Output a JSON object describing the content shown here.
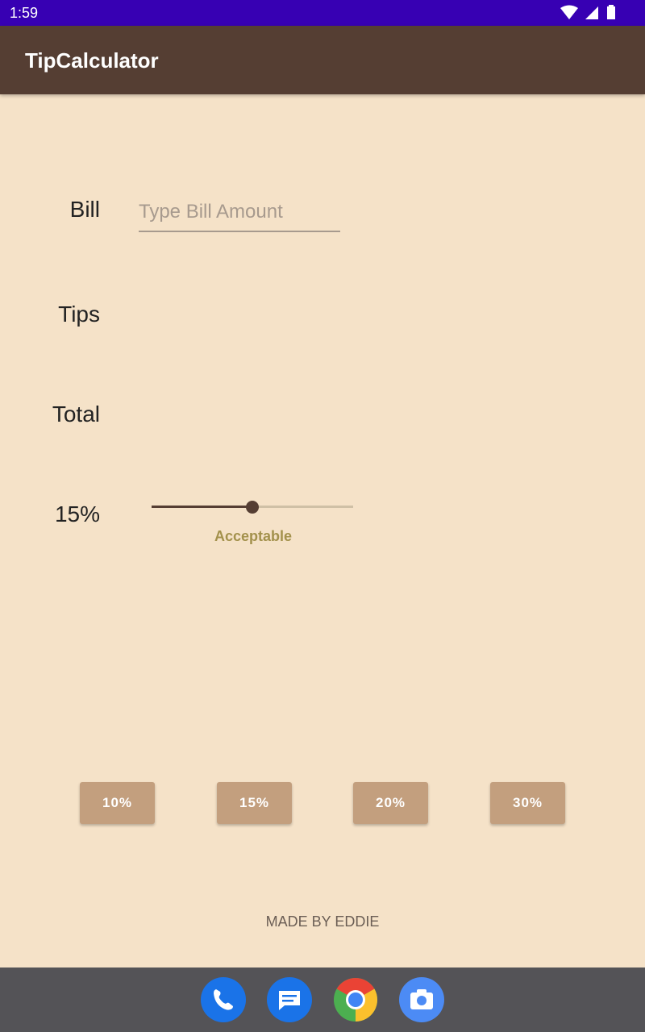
{
  "status_bar": {
    "time": "1:59"
  },
  "app_bar": {
    "title": "TipCalculator"
  },
  "form": {
    "bill_label": "Bill",
    "bill_placeholder": "Type Bill Amount",
    "bill_value": "",
    "tips_label": "Tips",
    "total_label": "Total",
    "percent_label": "15%",
    "slider_fraction": 0.5,
    "slider_description": "Acceptable"
  },
  "presets": [
    {
      "label": "10%"
    },
    {
      "label": "15%"
    },
    {
      "label": "20%"
    },
    {
      "label": "30%"
    }
  ],
  "footer": {
    "credit": "MADE BY EDDIE"
  },
  "dock": [
    "phone-icon",
    "messages-icon",
    "chrome-icon",
    "camera-icon"
  ],
  "colors": {
    "status_bar": "#3700b3",
    "app_bar": "#553e33",
    "background": "#f5e2c8",
    "button": "#c39f7e",
    "accent_text": "#a3914c"
  }
}
